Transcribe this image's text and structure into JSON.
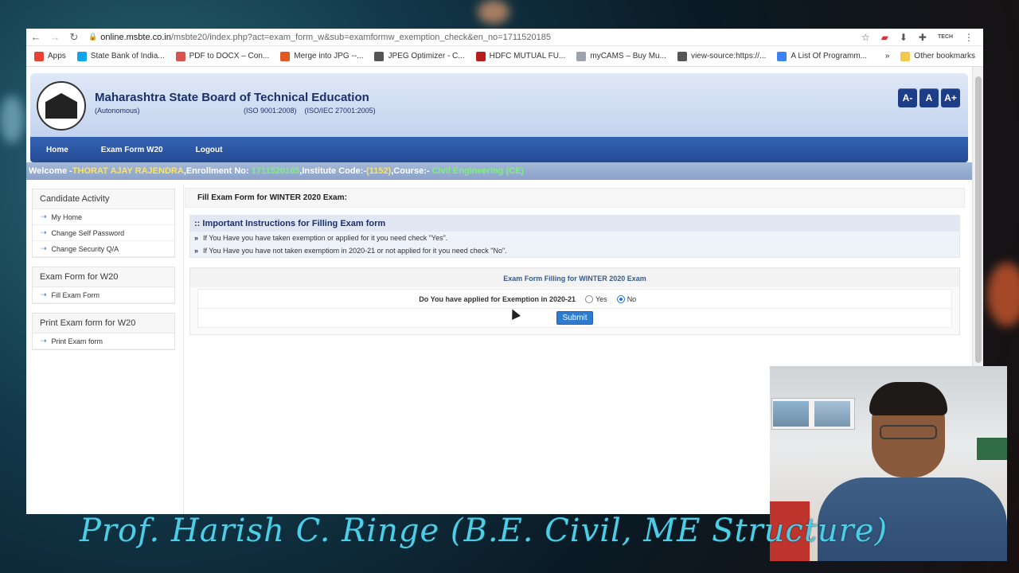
{
  "browser": {
    "url_host": "online.msbte.co.in",
    "url_path": "/msbte20/index.php?act=exam_form_w&sub=examformw_exemption_check&en_no=1711520185",
    "ext_label": "TECH",
    "bookmarks": [
      {
        "label": "Apps",
        "icon": "apps-grid-icon",
        "color": "#e94235"
      },
      {
        "label": "State Bank of India...",
        "icon": "sbi-icon",
        "color": "#0ea5e9"
      },
      {
        "label": "PDF to DOCX – Con...",
        "icon": "pdf-icon",
        "color": "#d9534f"
      },
      {
        "label": "Merge into JPG --...",
        "icon": "merge-icon",
        "color": "#e25822"
      },
      {
        "label": "JPEG Optimizer - C...",
        "icon": "globe-icon",
        "color": "#555555"
      },
      {
        "label": "HDFC MUTUAL FU...",
        "icon": "hdfc-icon",
        "color": "#b91c1c"
      },
      {
        "label": "myCAMS – Buy Mu...",
        "icon": "cams-icon",
        "color": "#9ca3af"
      },
      {
        "label": "view-source:https://...",
        "icon": "globe-icon",
        "color": "#555555"
      },
      {
        "label": "A List Of Programm...",
        "icon": "doc-icon",
        "color": "#3b82f6"
      }
    ],
    "overflow": "»",
    "other_bookmarks": "Other bookmarks"
  },
  "site": {
    "org_name": "Maharashtra State Board of Technical Education",
    "org_sub": "(Autonomous)",
    "org_iso": "(ISO 9001:2008)    (ISO/IEC 27001:2005)",
    "font_buttons": [
      "A-",
      "A",
      "A+"
    ],
    "nav": [
      "Home",
      "Exam Form W20",
      "Logout"
    ]
  },
  "welcome": {
    "prefix": "Welcome -",
    "name": "THORAT AJAY RAJENDRA",
    "enroll_label": ",Enrollment No: ",
    "enroll_no": "1711520185",
    "inst_label": ",Institute Code:-",
    "inst_code": "(1152)",
    "course_label": ",Course:- ",
    "course": "Civil Engineering (CE)"
  },
  "sidebar": {
    "sections": [
      {
        "title": "Candidate Activity",
        "items": [
          "My Home",
          "Change Self Password",
          "Change Security Q/A"
        ]
      },
      {
        "title": "Exam Form for W20",
        "items": [
          "Fill Exam Form"
        ]
      },
      {
        "title": "Print Exam form for W20",
        "items": [
          "Print Exam form"
        ]
      }
    ]
  },
  "content": {
    "heading": "Fill Exam Form for WINTER 2020 Exam:",
    "instructions_title": ":: Important Instructions for Filling Exam form",
    "instructions": [
      "If You Have you have taken exemption or applied for it you need check \"Yes\".",
      "If You Have you have not taken exemptiom in 2020-21 or not applied for it you need check \"No\"."
    ],
    "bullet": "»",
    "form_title": "Exam Form Filling for WINTER 2020 Exam",
    "question": "Do You have applied for Exemption in 2020-21",
    "option_yes": "Yes",
    "option_no": "No",
    "selected": "No",
    "submit": "Submit"
  },
  "caption": "Prof. Harish C. Ringe (B.E. Civil, ME Structure)"
}
